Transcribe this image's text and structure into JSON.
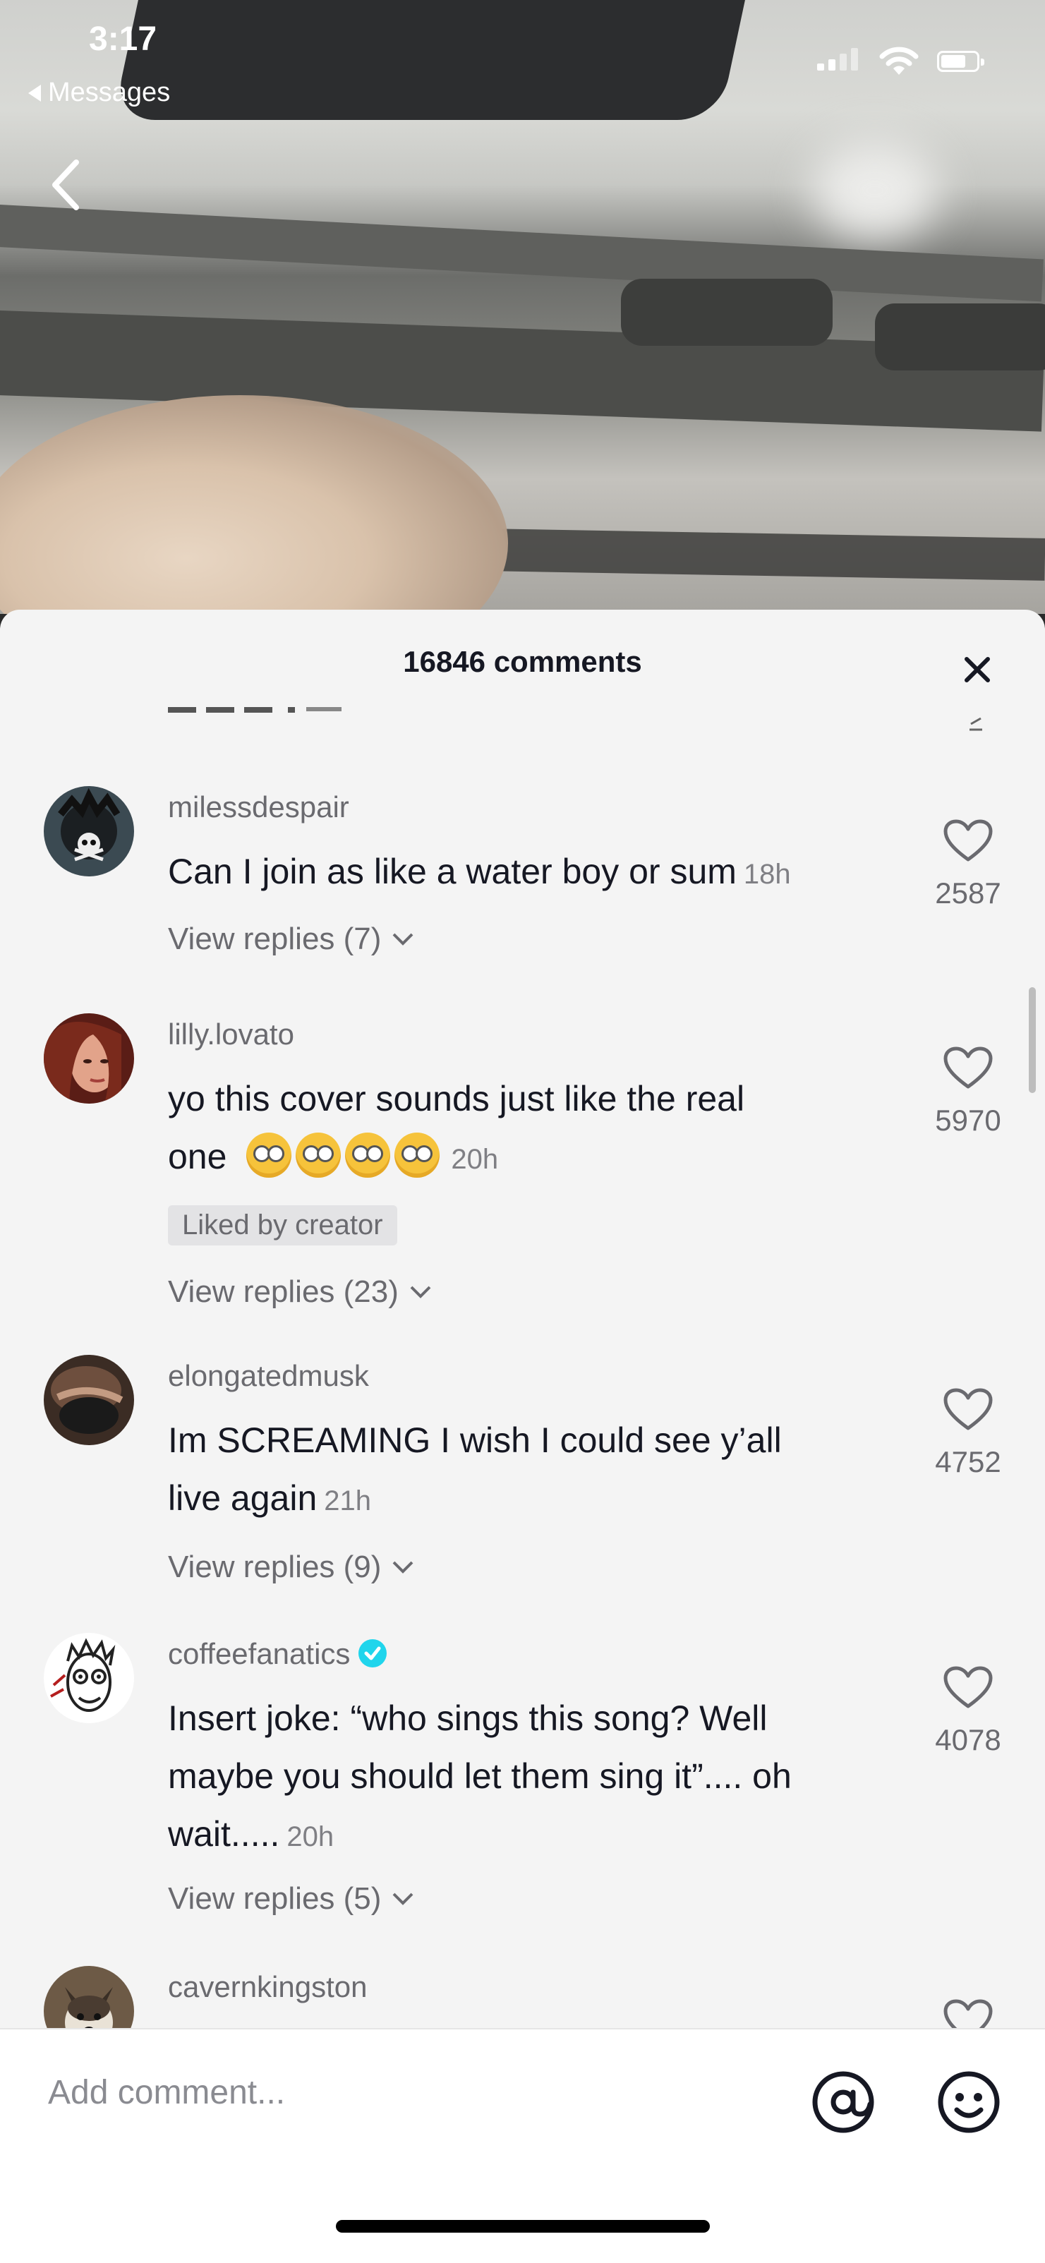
{
  "status_bar": {
    "time": "3:17",
    "back_app": "Messages"
  },
  "sheet": {
    "title": "16846 comments"
  },
  "comments": [
    {
      "username": "milessdespair",
      "text": "Can I join as like a water boy or sum",
      "time": "18h",
      "likes": "2587",
      "replies": "View replies (7)"
    },
    {
      "username": "lilly.lovato",
      "text_line1": "yo this cover sounds just like the real",
      "text_line2": "one",
      "time": "20h",
      "likes": "5970",
      "badge": "Liked by creator",
      "replies": "View replies (23)"
    },
    {
      "username": "elongatedmusk",
      "text_line1": "Im SCREAMING I wish I could see y’all",
      "text_line2": "live again",
      "time": "21h",
      "likes": "4752",
      "replies": "View replies (9)"
    },
    {
      "username": "coffeefanatics",
      "verified": true,
      "text_line1": "Insert joke: “who sings this song? Well",
      "text_line2": "maybe you should let them sing it”.... oh",
      "text_line3": "wait.....",
      "time": "20h",
      "likes": "4078",
      "replies": "View replies (5)"
    },
    {
      "username": "cavernkingston"
    }
  ],
  "input": {
    "placeholder": "Add comment..."
  },
  "colors": {
    "sheet_bg": "#f4f4f4",
    "verified": "#20d5ec",
    "text": "#161823",
    "muted": "#6a6a6f"
  }
}
